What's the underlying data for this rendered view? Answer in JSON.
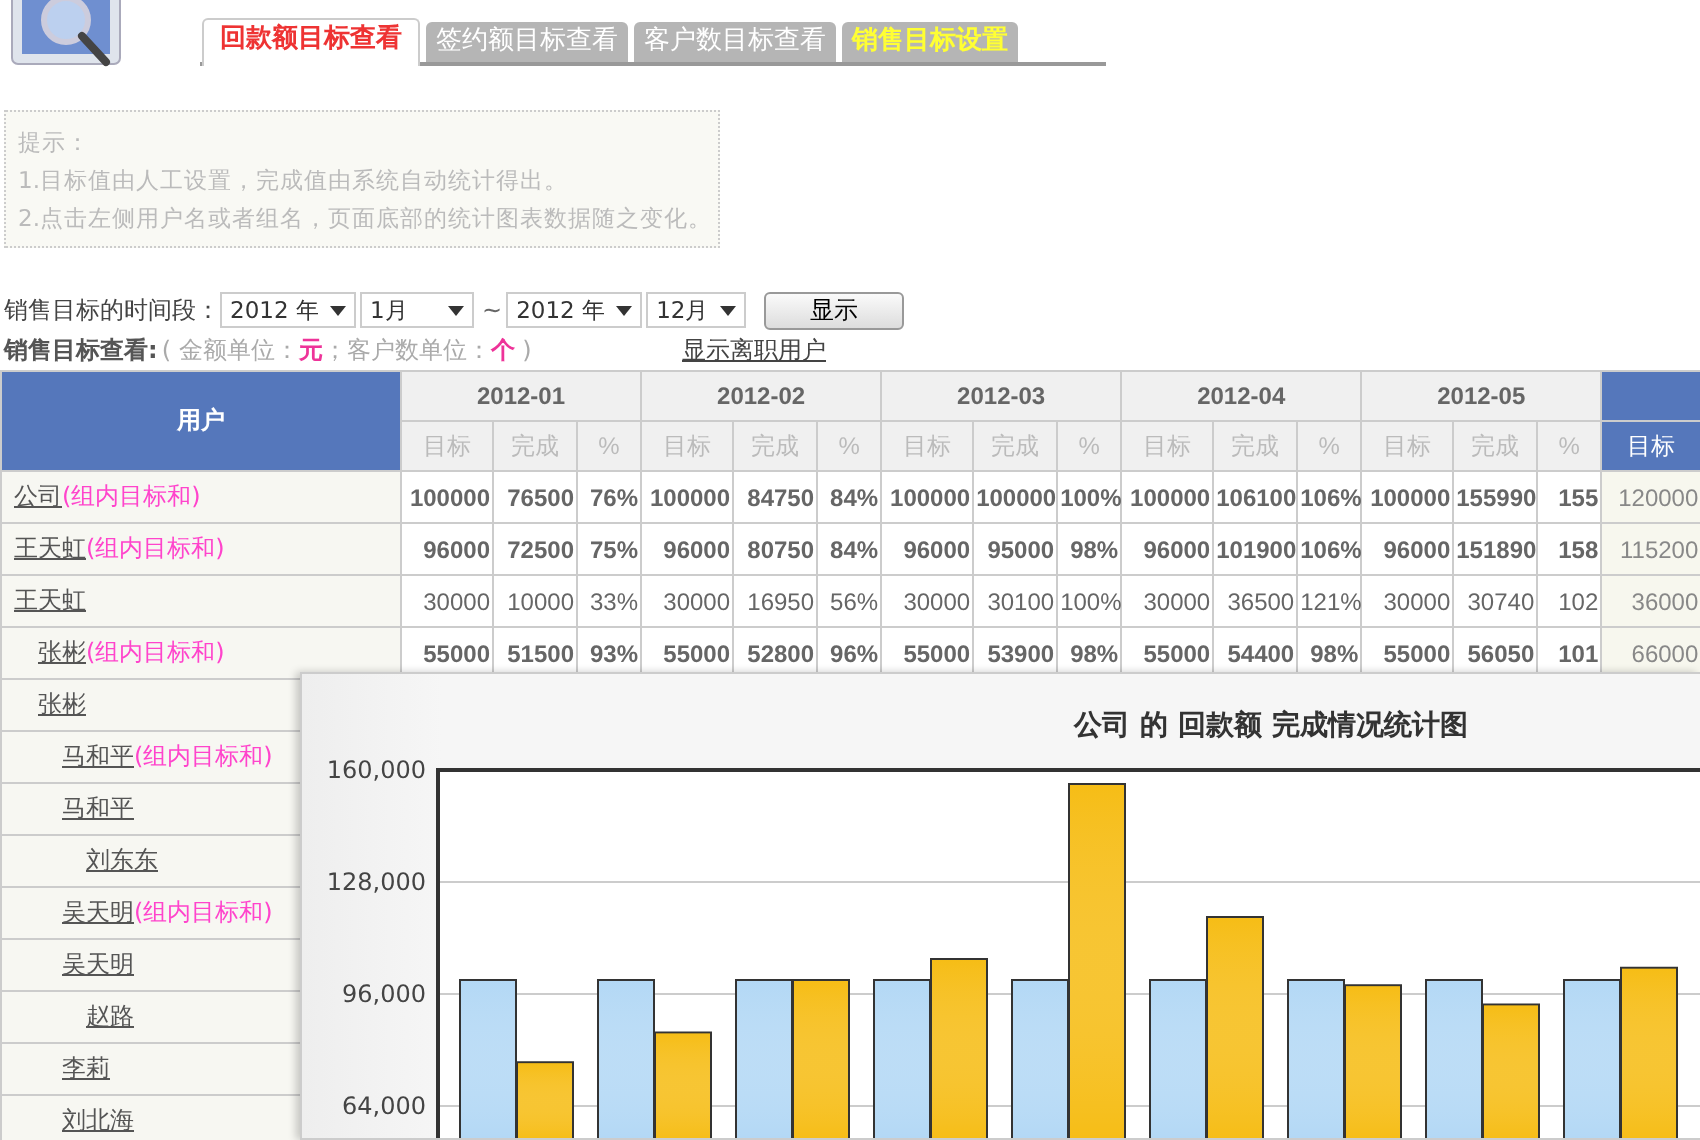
{
  "tabs": [
    {
      "label": "回款额目标查看",
      "selected": true,
      "kind": "view"
    },
    {
      "label": "签约额目标查看",
      "selected": false,
      "kind": "view"
    },
    {
      "label": "客户数目标查看",
      "selected": false,
      "kind": "view"
    },
    {
      "label": "销售目标设置",
      "selected": false,
      "kind": "settings"
    }
  ],
  "hint": {
    "title": "提示：",
    "lines": [
      "1.目标值由人工设置，完成值由系统自动统计得出。",
      "2.点击左侧用户名或者组名，页面底部的统计图表数据随之变化。"
    ]
  },
  "period": {
    "label": "销售目标的时间段：",
    "from_year": "2012 年",
    "from_month": "1月",
    "separator": "~",
    "to_year": "2012 年",
    "to_month": "12月",
    "button": "显示"
  },
  "view": {
    "label": "销售目标查看:",
    "note": "( 金额单位：**元**；客户数单位：**个** )",
    "link": "显示离职用户"
  },
  "table": {
    "user_header": "用户",
    "groups": [
      {
        "kind": "month",
        "label": "2012-01",
        "columns": [
          "目标",
          "完成",
          "%"
        ]
      },
      {
        "kind": "month",
        "label": "2012-02",
        "columns": [
          "目标",
          "完成",
          "%"
        ]
      },
      {
        "kind": "month",
        "label": "2012-03",
        "columns": [
          "目标",
          "完成",
          "%"
        ]
      },
      {
        "kind": "month",
        "label": "2012-04",
        "columns": [
          "目标",
          "完成",
          "%"
        ]
      },
      {
        "kind": "month",
        "label": "2012-05",
        "columns": [
          "目标",
          "完成",
          "%"
        ]
      },
      {
        "kind": "highlighted",
        "columns": [
          "目标"
        ]
      }
    ],
    "rows": [
      {
        "name": "公司",
        "suffix": "(组内目标和)",
        "cells": [
          "100000",
          "76500",
          "76%",
          "100000",
          "84750",
          "84%",
          "100000",
          "100000",
          "100%",
          "100000",
          "106100",
          "106%",
          "100000",
          "155990",
          "155",
          "120000"
        ]
      },
      {
        "name": "王天虹",
        "suffix": "(组内目标和)",
        "cells": [
          "96000",
          "72500",
          "75%",
          "96000",
          "80750",
          "84%",
          "96000",
          "95000",
          "98%",
          "96000",
          "101900",
          "106%",
          "96000",
          "151890",
          "158",
          "115200"
        ]
      },
      {
        "name": "王天虹",
        "cells": [
          "30000",
          "10000",
          "33%",
          "30000",
          "16950",
          "56%",
          "30000",
          "30100",
          "100%",
          "30000",
          "36500",
          "121%",
          "30000",
          "30740",
          "102",
          "36000"
        ],
        "children": [
          {
            "name": "张彬",
            "suffix": "(组内目标和)",
            "cells": [
              "55000",
              "51500",
              "93%",
              "55000",
              "52800",
              "96%",
              "55000",
              "53900",
              "98%",
              "55000",
              "54400",
              "98%",
              "55000",
              "56050",
              "101",
              "66000"
            ]
          },
          {
            "name": "张彬",
            "children": [
              {
                "name": "马和平",
                "suffix": "(组内目标和)"
              },
              {
                "name": "马和平",
                "children": [
                  {
                    "name": "刘东东"
                  }
                ]
              },
              {
                "name": "吴天明",
                "suffix": "(组内目标和)"
              },
              {
                "name": "吴天明",
                "children": [
                  {
                    "name": "赵路"
                  }
                ]
              },
              {
                "name": "李莉"
              },
              {
                "name": "刘北海"
              }
            ]
          }
        ]
      }
    ]
  },
  "chart": {
    "title": "公司 的 回款额 完成情况统计图",
    "chart_data": {
      "type": "bar",
      "stacked": false,
      "grid": true,
      "ylim": [
        54000,
        160000
      ],
      "yticks": [
        {
          "value": 64000,
          "label": "64,000"
        },
        {
          "value": 96000,
          "label": "96,000"
        },
        {
          "value": 128000,
          "label": "128,000"
        },
        {
          "value": 160000,
          "label": "160,000"
        }
      ],
      "series": [
        {
          "color": "#b3d8f5",
          "values": [
            100000,
            100000,
            100000,
            100000,
            100000,
            100000,
            100000,
            100000,
            100000
          ]
        },
        {
          "color": "#f6bd16",
          "values": [
            76500,
            85000,
            100000,
            106000,
            156000,
            118000,
            98500,
            93000,
            103500
          ]
        }
      ]
    }
  }
}
